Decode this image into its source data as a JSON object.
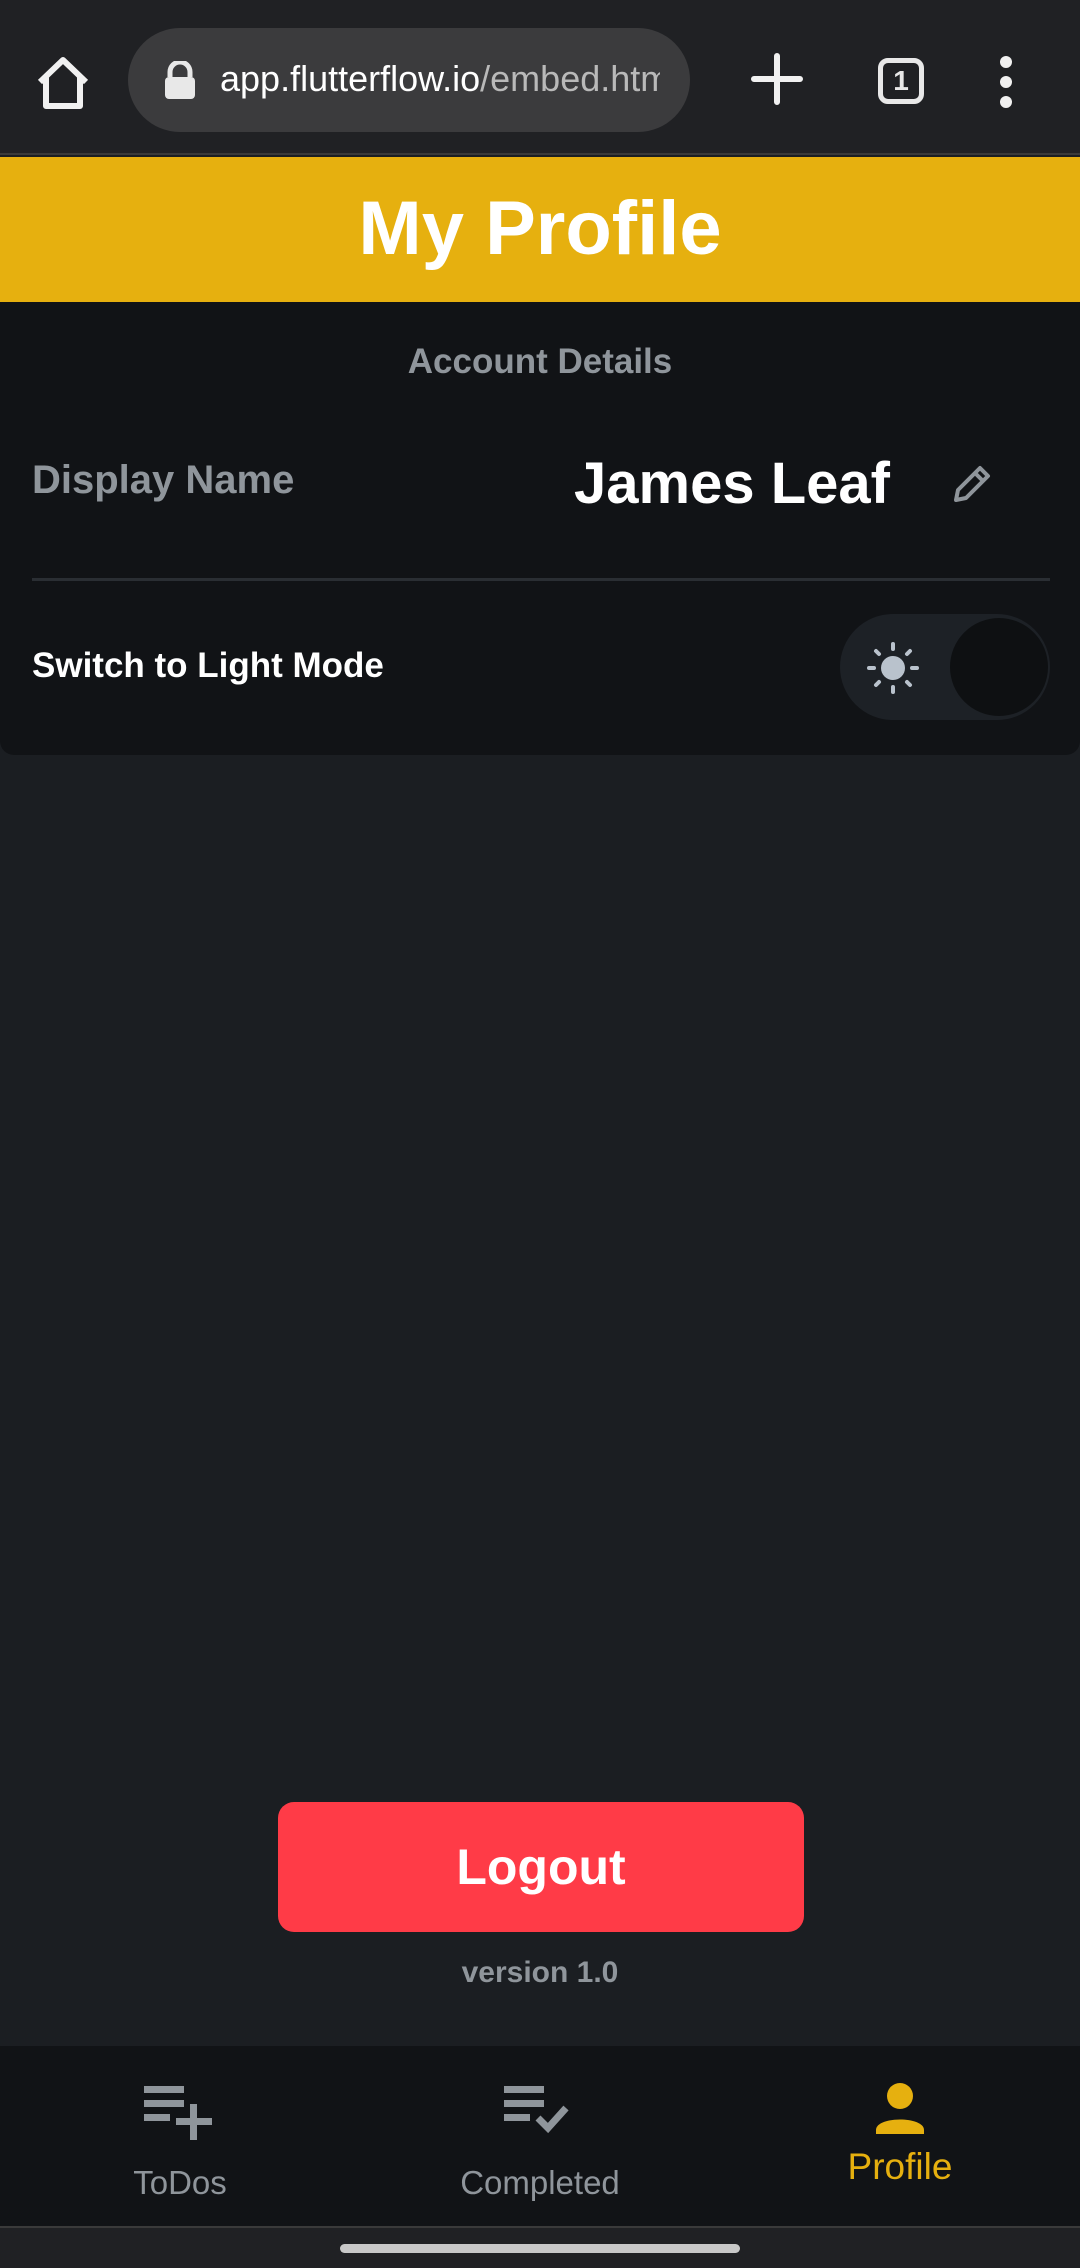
{
  "browser": {
    "url_host": "app.flutterflow.io",
    "url_path": "/embed.html",
    "tab_count": "1"
  },
  "header": {
    "title": "My Profile",
    "background_color": "#e6b00f"
  },
  "account": {
    "section_title": "Account Details",
    "display_name_label": "Display Name",
    "display_name_value": "James Leaf",
    "light_mode_label": "Switch to Light Mode",
    "light_mode_enabled": false
  },
  "actions": {
    "logout_label": "Logout",
    "logout_color": "#ff3b47",
    "version": "version 1.0"
  },
  "nav": {
    "items": [
      {
        "label": "ToDos",
        "icon": "playlist-add-icon",
        "active": false
      },
      {
        "label": "Completed",
        "icon": "playlist-check-icon",
        "active": false
      },
      {
        "label": "Profile",
        "icon": "person-icon",
        "active": true
      }
    ],
    "active_color": "#e6b00f"
  }
}
